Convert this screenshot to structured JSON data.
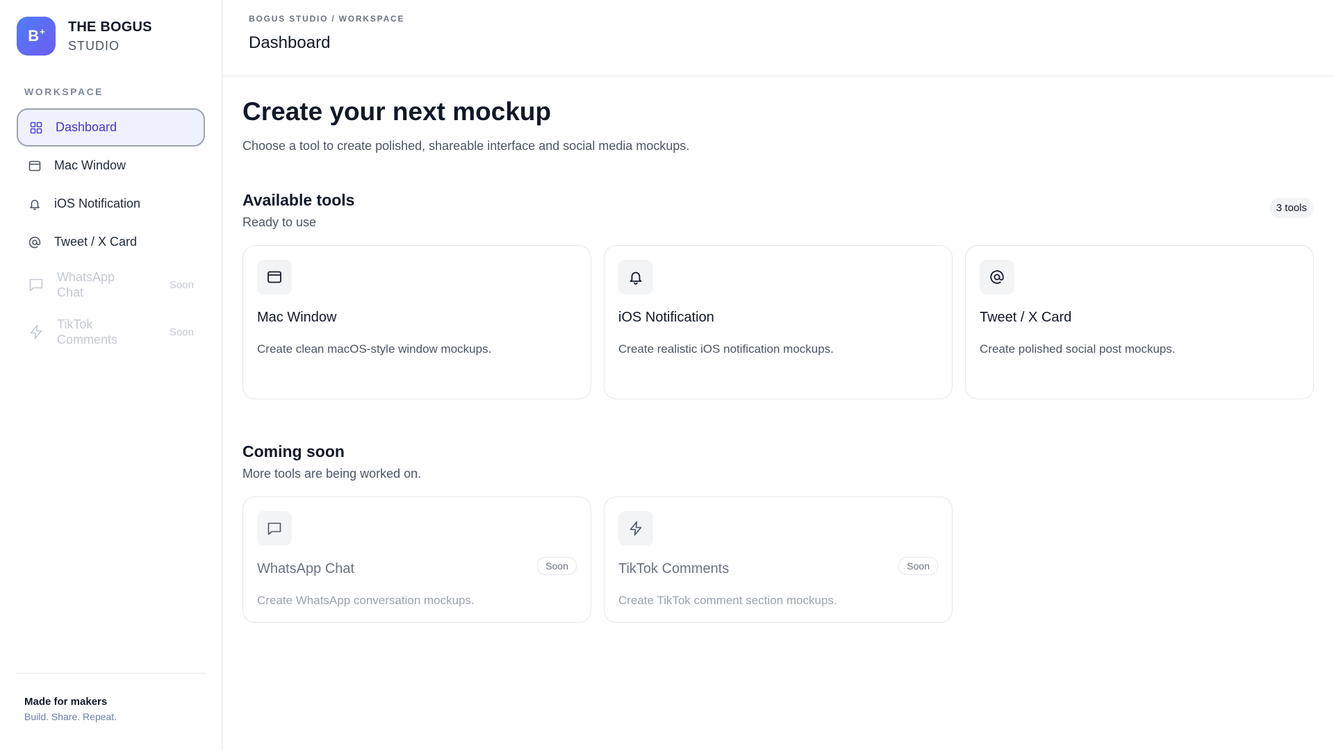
{
  "brand": {
    "logo_letter": "B",
    "logo_mark": "+",
    "name": "THE BOGUS",
    "subtitle": "STUDIO"
  },
  "sidebar": {
    "section_label": "WORKSPACE",
    "items": [
      {
        "label": "Dashboard",
        "icon": "grid-icon",
        "active": true
      },
      {
        "label": "Mac Window",
        "icon": "window-icon"
      },
      {
        "label": "iOS Notification",
        "icon": "bell-icon"
      },
      {
        "label": "Tweet / X Card",
        "icon": "at-icon"
      },
      {
        "label": "WhatsApp Chat",
        "icon": "chat-icon",
        "badge": "Soon",
        "disabled": true
      },
      {
        "label": "TikTok Comments",
        "icon": "bolt-icon",
        "badge": "Soon",
        "disabled": true
      }
    ],
    "footer": {
      "title": "Made for makers",
      "subtitle": "Build. Share. Repeat."
    }
  },
  "header": {
    "breadcrumb": "BOGUS STUDIO / WORKSPACE",
    "title": "Dashboard"
  },
  "main": {
    "title": "Create your next mockup",
    "lead": "Choose a tool to create polished, shareable interface and social media mockups.",
    "available": {
      "title": "Available tools",
      "subtitle": "Ready to use",
      "count": "3 tools",
      "cards": [
        {
          "title": "Mac Window",
          "desc": "Create clean macOS-style window mockups.",
          "icon": "window-icon"
        },
        {
          "title": "iOS Notification",
          "desc": "Create realistic iOS notification mockups.",
          "icon": "bell-icon"
        },
        {
          "title": "Tweet / X Card",
          "desc": "Create polished social post mockups.",
          "icon": "at-icon"
        }
      ]
    },
    "coming": {
      "title": "Coming soon",
      "subtitle": "More tools are being worked on.",
      "cards": [
        {
          "title": "WhatsApp Chat",
          "desc": "Create WhatsApp conversation mockups.",
          "badge": "Soon",
          "icon": "chat-icon"
        },
        {
          "title": "TikTok Comments",
          "desc": "Create TikTok comment section mockups.",
          "badge": "Soon",
          "icon": "bolt-icon"
        }
      ]
    }
  },
  "colors": {
    "accent": "#4f46e5",
    "active_bg": "#eef1fe",
    "logo_from": "#4f7cf7",
    "logo_to": "#6d5df0"
  }
}
